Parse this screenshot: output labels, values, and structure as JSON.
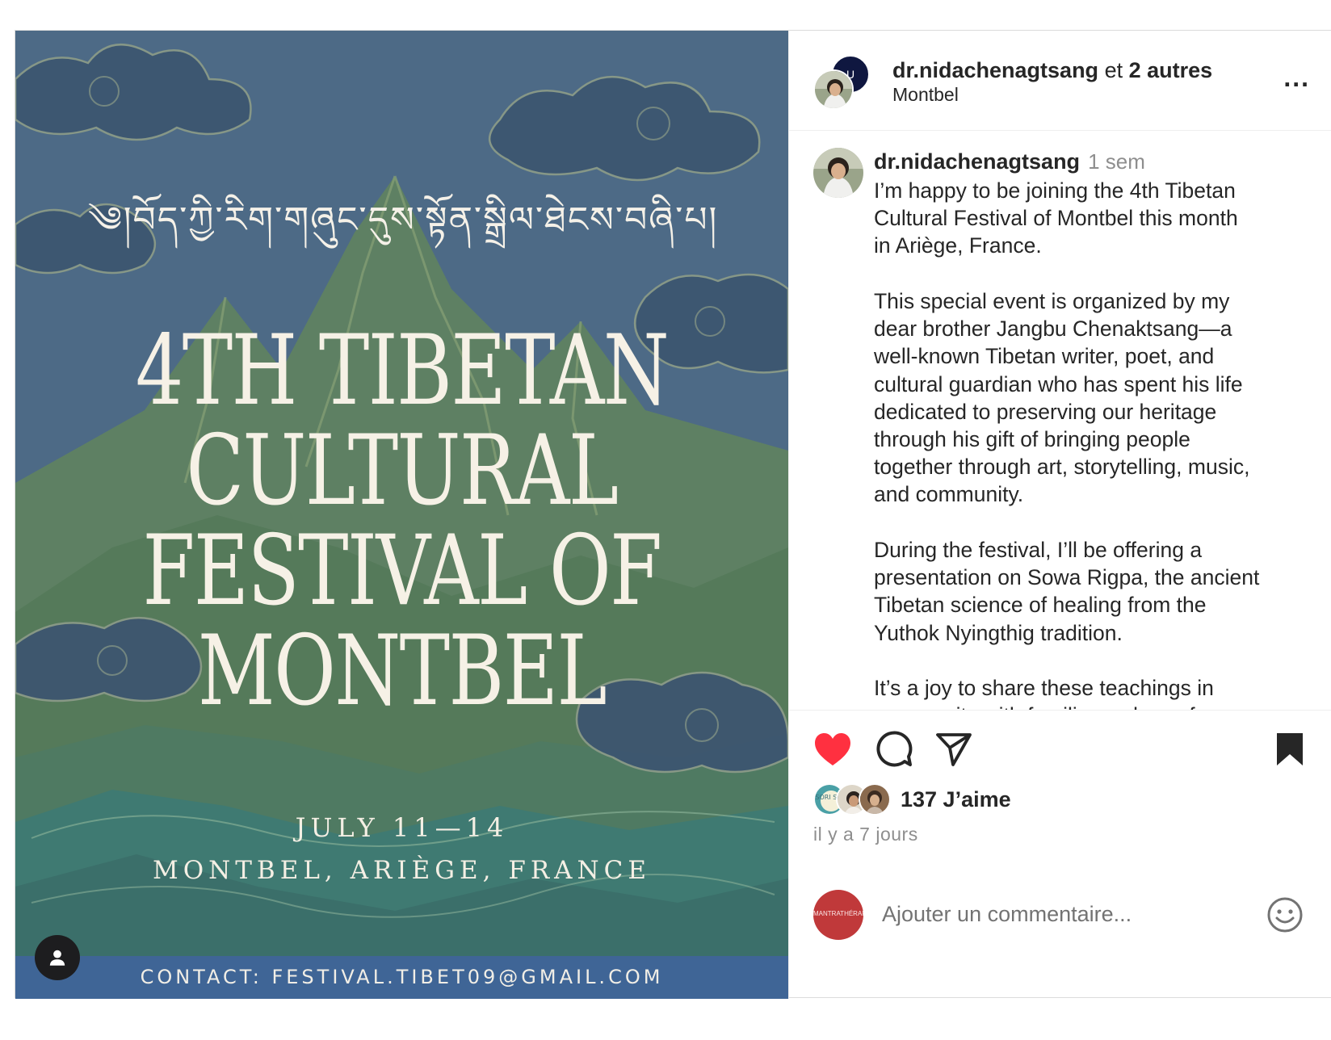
{
  "poster": {
    "tibetan_title": "༄།བོད་ཀྱི་རིག་གཞུང་དུས་སྟོན་སྒྲིལ་ཐེངས་བཞི་པ།",
    "headline_lines": [
      "4TH TIBETAN",
      "CULTURAL",
      "FESTIVAL OF",
      "MONTBEL"
    ],
    "dates": "JULY 11—14",
    "place": "MONTBEL, ARIÈGE, FRANCE",
    "contact": "CONTACT: FESTIVAL.TIBET09@GMAIL.COM",
    "colors": {
      "sky": "#4e6a86",
      "mountain": "#4f7a5d",
      "contact_bar": "#3f6596",
      "text": "#f6f1e6"
    }
  },
  "header": {
    "username": "dr.nidachenagtsang",
    "collab_joiner": " et ",
    "collab_others": "2 autres",
    "location": "Montbel",
    "more_label": "...",
    "back_avatar_text": "U"
  },
  "caption": {
    "username": "dr.nidachenagtsang",
    "time": "1 sem",
    "paragraphs": [
      "I’m happy to be joining the 4th Tibetan\nCultural Festival of Montbel this month\nin Ariège, France.",
      "This special event is organized by my\ndear brother Jangbu Chenaktsang—a\nwell-known Tibetan writer, poet, and\ncultural guardian who has spent his life\ndedicated to preserving our heritage\nthrough his gift of bringing people\ntogether through art, storytelling, music,\nand community.",
      "During the festival, I’ll be offering a\npresentation on Sowa Rigpa, the ancient\nTibetan science of healing from the\nYuthok Nyingthig tradition.",
      "It’s a joy to share these teachings in\ncommunity with familiar and new faces."
    ]
  },
  "actions": {
    "likes_text": "137 J’aime",
    "liker_avatar_text": "SORI SHO",
    "time_ago": "il y a 7 jours",
    "comment_placeholder": "Ajouter un commentaire...",
    "comment_avatar_text": "MANTRATHÉRAPIE",
    "icons": [
      "heart-filled",
      "comment",
      "share",
      "bookmark-filled",
      "emoji"
    ],
    "heart_color": "#ff3040"
  }
}
